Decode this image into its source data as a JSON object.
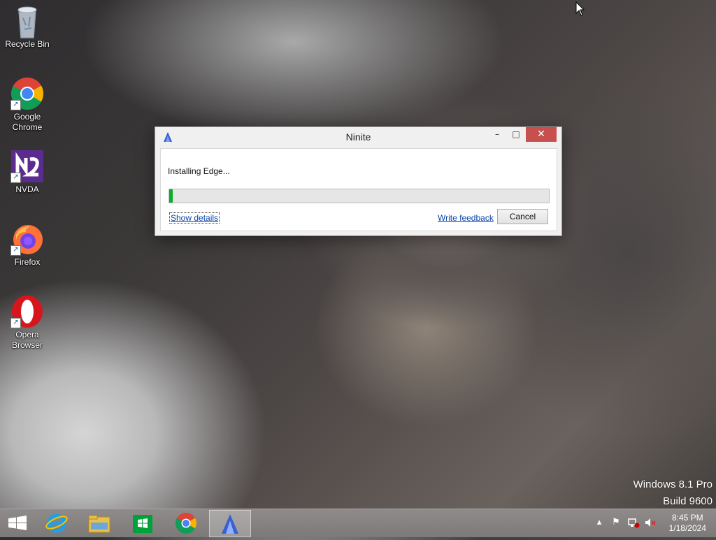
{
  "desktop": {
    "icons": [
      {
        "label": "Recycle Bin"
      },
      {
        "label": "Google\nChrome"
      },
      {
        "label": "NVDA"
      },
      {
        "label": "Firefox"
      },
      {
        "label": "Opera\nBrowser"
      }
    ],
    "watermark": {
      "line1": "Windows 8.1 Pro",
      "line2": "Build 9600"
    }
  },
  "dialog": {
    "title": "Ninite",
    "status_text": "Installing Edge...",
    "progress": 0.01,
    "show_details_label": "Show details",
    "feedback_label": "Write feedback",
    "cancel_label": "Cancel",
    "min_icon": "minimize-icon",
    "max_icon": "maximize-icon",
    "close_icon": "close-icon"
  },
  "taskbar": {
    "apps": [
      "internet-explorer-icon",
      "file-explorer-icon",
      "store-icon",
      "chrome-icon",
      "ninite-icon"
    ],
    "active_app": "ninite-icon",
    "clock": {
      "time": "8:45 PM",
      "date": "1/18/2024"
    }
  },
  "colors": {
    "progress": "#06b025",
    "close": "#c7504e",
    "link": "#0645ad"
  }
}
